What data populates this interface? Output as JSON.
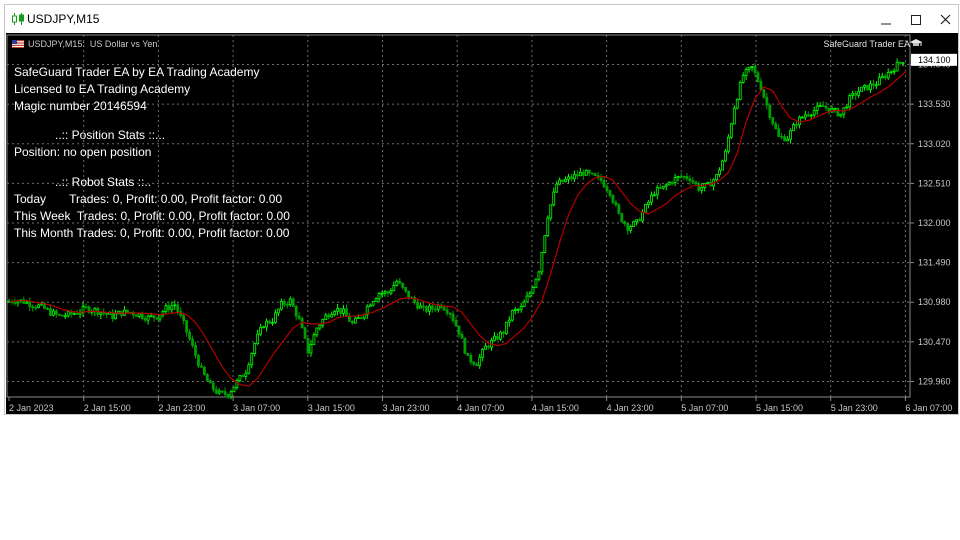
{
  "window": {
    "title": "USDJPY,M15"
  },
  "chart_header": {
    "symbol_line": "USDJPY,M15:  US Dollar vs Yen",
    "ea_label": "SafeGuard Trader EA"
  },
  "info_panel": {
    "line1": "SafeGuard Trader EA by EA Trading Academy",
    "line2": "Licensed to EA Trading Academy",
    "line3": "Magic number 20146594",
    "position_header": "..:: Position Stats ::...",
    "position_text": "Position: no open position",
    "robot_header": "..:: Robot Stats ::..",
    "today": "Today       Trades: 0, Profit: 0.00, Profit factor: 0.00",
    "week": "This Week  Trades: 0, Profit: 0.00, Profit factor: 0.00",
    "month": "This Month Trades: 0, Profit: 0.00, Profit factor: 0.00"
  },
  "colors": {
    "bull": "#00ff00",
    "bear": "#00a000",
    "ma": "#b40000",
    "grid": "#6e6e6e",
    "axis_text": "#c8c8c8"
  },
  "chart_data": {
    "type": "line",
    "title": "",
    "xlabel": "",
    "ylabel": "",
    "x_tick_labels": [
      "2 Jan 2023",
      "2 Jan 15:00",
      "2 Jan 23:00",
      "3 Jan 07:00",
      "3 Jan 15:00",
      "3 Jan 23:00",
      "4 Jan 07:00",
      "4 Jan 15:00",
      "4 Jan 23:00",
      "5 Jan 07:00",
      "5 Jan 15:00",
      "5 Jan 23:00",
      "6 Jan 07:00"
    ],
    "y_ticks": [
      "134.040",
      "133.530",
      "133.020",
      "132.510",
      "132.000",
      "131.490",
      "130.980",
      "130.470",
      "129.960"
    ],
    "ylim": [
      129.76,
      134.42
    ],
    "grid": true,
    "series": [
      {
        "style": "candlestick-close",
        "values": [
          130.98,
          131.01,
          130.99,
          130.95,
          130.92,
          130.85,
          130.8,
          130.82,
          130.85,
          130.9,
          130.88,
          130.84,
          130.8,
          130.85,
          130.85,
          130.82,
          130.78,
          130.8,
          130.9,
          130.95,
          130.7,
          130.4,
          130.1,
          129.9,
          129.8,
          129.8,
          129.95,
          130.1,
          130.45,
          130.7,
          130.75,
          130.95,
          131.0,
          130.75,
          130.35,
          130.65,
          130.8,
          130.9,
          130.85,
          130.7,
          130.8,
          130.98,
          131.1,
          131.1,
          131.25,
          131.1,
          130.98,
          130.88,
          130.9,
          130.95,
          130.85,
          130.6,
          130.25,
          130.2,
          130.4,
          130.5,
          130.6,
          130.85,
          130.9,
          131.1,
          131.4,
          132.1,
          132.5,
          132.55,
          132.6,
          132.65,
          132.6,
          132.55,
          132.4,
          132.1,
          131.95,
          132.0,
          132.2,
          132.4,
          132.45,
          132.55,
          132.6,
          132.58,
          132.45,
          132.48,
          132.6,
          132.9,
          133.5,
          133.9,
          134.0,
          133.75,
          133.4,
          133.1,
          133.1,
          133.3,
          133.4,
          133.45,
          133.5,
          133.45,
          133.4,
          133.6,
          133.7,
          133.75,
          133.8,
          133.9,
          134.0,
          134.1
        ]
      },
      {
        "style": "moving-average",
        "values": [
          130.98,
          131.0,
          131.0,
          130.98,
          130.96,
          130.93,
          130.89,
          130.86,
          130.85,
          130.86,
          130.86,
          130.85,
          130.84,
          130.84,
          130.84,
          130.84,
          130.83,
          130.82,
          130.83,
          130.85,
          130.82,
          130.72,
          130.55,
          130.35,
          130.15,
          130.0,
          129.92,
          129.9,
          130.0,
          130.18,
          130.35,
          130.5,
          130.65,
          130.72,
          130.7,
          130.7,
          130.72,
          130.78,
          130.8,
          130.8,
          130.82,
          130.85,
          130.9,
          130.96,
          131.02,
          131.04,
          131.02,
          130.98,
          130.95,
          130.93,
          130.92,
          130.85,
          130.7,
          130.55,
          130.45,
          130.42,
          130.45,
          130.55,
          130.65,
          130.8,
          131.0,
          131.35,
          131.75,
          132.1,
          132.35,
          132.5,
          132.58,
          132.6,
          132.55,
          132.4,
          132.25,
          132.15,
          132.12,
          132.18,
          132.25,
          132.35,
          132.42,
          132.48,
          132.48,
          132.5,
          132.55,
          132.65,
          132.9,
          133.3,
          133.6,
          133.75,
          133.7,
          133.5,
          133.35,
          133.3,
          133.32,
          133.37,
          133.42,
          133.45,
          133.44,
          133.48,
          133.55,
          133.62,
          133.68,
          133.75,
          133.85,
          133.95
        ]
      }
    ]
  }
}
